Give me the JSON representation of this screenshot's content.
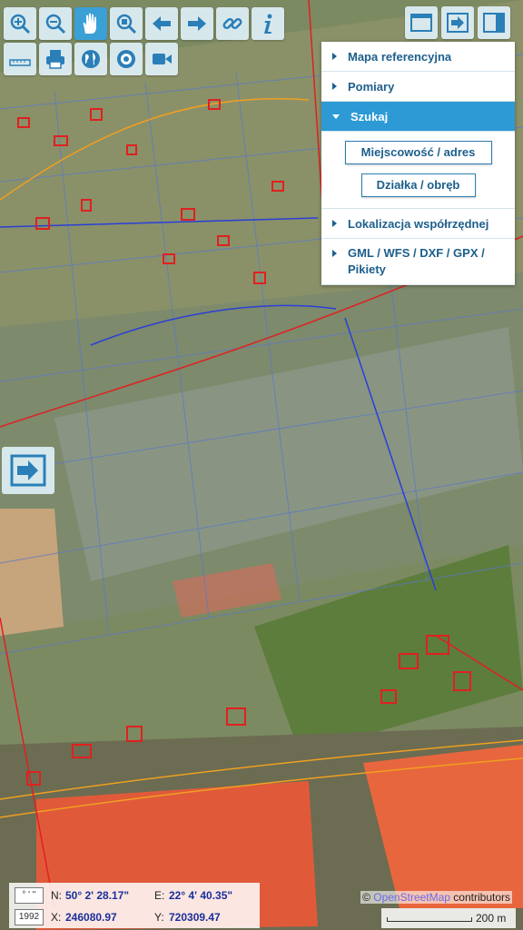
{
  "toolbar": {
    "icons": [
      "zoom-in-icon",
      "zoom-out-icon",
      "pan-hand-icon",
      "zoom-extent-icon",
      "back-icon",
      "forward-icon",
      "link-icon",
      "info-icon",
      "measure-ruler-icon",
      "print-icon",
      "globe-icon",
      "target-icon",
      "video-icon"
    ],
    "active": "pan-hand-icon"
  },
  "panel_toggles": [
    "window-icon",
    "panel-arrow-icon",
    "sidebar-icon"
  ],
  "menu": {
    "items": [
      {
        "label": "Mapa referencyjna",
        "open": false
      },
      {
        "label": "Pomiary",
        "open": false
      },
      {
        "label": "Szukaj",
        "open": true
      },
      {
        "label": "Lokalizacja współrzędnej",
        "open": false
      },
      {
        "label": "GML / WFS / DXF / GPX / Pikiety",
        "open": false
      }
    ],
    "search_buttons": [
      "Miejscowość / adres",
      "Działka / obręb"
    ]
  },
  "coords": {
    "format_badge": "° ' ''",
    "system_badge": "1992",
    "n_label": "N:",
    "n_value": "50° 2' 28.17\"",
    "e_label": "E:",
    "e_value": "22° 4' 40.35\"",
    "x_label": "X:",
    "x_value": "246080.97",
    "y_label": "Y:",
    "y_value": "720309.47"
  },
  "attribution": {
    "prefix": "© ",
    "link": "OpenStreetMap",
    "suffix": " contributors"
  },
  "scale": {
    "label": "200 m"
  },
  "colors": {
    "accent": "#2d9ad6",
    "parcel_red": "#e02020",
    "parcel_blue": "#2a3fd8",
    "toolbar_bg": "#def0f7"
  }
}
